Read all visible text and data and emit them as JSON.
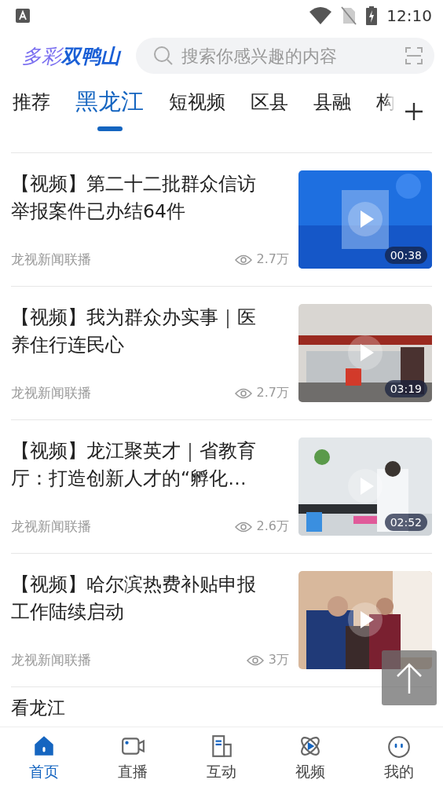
{
  "status_bar": {
    "time": "12:10"
  },
  "header": {
    "logo_light": "多彩",
    "logo_bold": "双鸭山",
    "search": {
      "placeholder": "搜索你感兴趣的内容"
    }
  },
  "tabs": [
    {
      "label": "推荐",
      "selected": false
    },
    {
      "label": "黑龙江",
      "selected": true
    },
    {
      "label": "短视频",
      "selected": false
    },
    {
      "label": "区县",
      "selected": false
    },
    {
      "label": "县融",
      "selected": false
    },
    {
      "label": "构",
      "selected": false
    }
  ],
  "feed": [
    {
      "title": "【视频】第二十二批群众信访举报案件已办结64件",
      "source": "龙视新闻联播",
      "views": "2.7万",
      "thumb": {
        "kind": "graphic",
        "duration": "00:38"
      }
    },
    {
      "title": "【视频】我为群众办实事｜医养住行连民心",
      "source": "龙视新闻联播",
      "views": "2.7万",
      "thumb": {
        "kind": "office",
        "duration": "03:19"
      }
    },
    {
      "title": "【视频】龙江聚英才｜省教育厅：打造创新人才的“孵化…",
      "source": "龙视新闻联播",
      "views": "2.6万",
      "thumb": {
        "kind": "lab",
        "duration": "02:52"
      }
    },
    {
      "title": "【视频】哈尔滨热费补贴申报工作陆续启动",
      "source": "龙视新闻联播",
      "views": "3万",
      "thumb": {
        "kind": "room"
      }
    }
  ],
  "next_item": {
    "title": "看龙江"
  },
  "bottom_nav": [
    {
      "label": "首页",
      "kind": "home",
      "selected": true
    },
    {
      "label": "直播",
      "kind": "camera",
      "selected": false
    },
    {
      "label": "互动",
      "kind": "building",
      "selected": false
    },
    {
      "label": "视频",
      "kind": "orbit",
      "selected": false
    },
    {
      "label": "我的",
      "kind": "face",
      "selected": false
    }
  ]
}
